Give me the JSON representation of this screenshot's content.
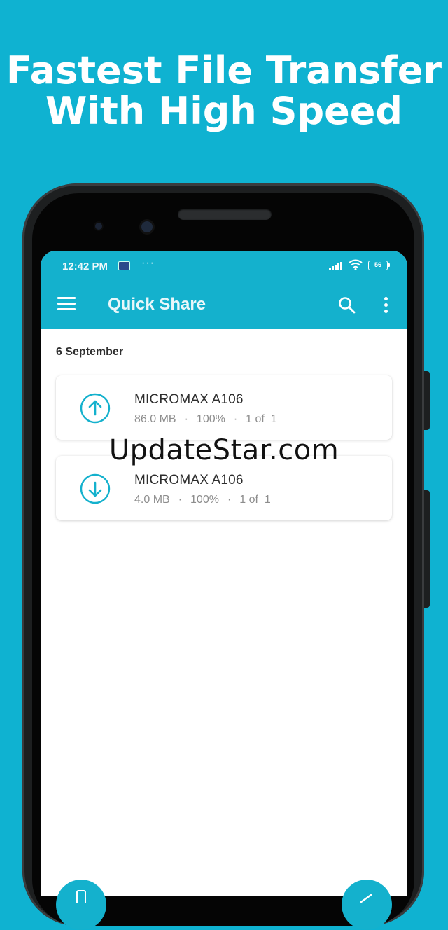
{
  "headline": {
    "line1": "Fastest File Transfer",
    "line2": "With High Speed"
  },
  "status_bar": {
    "time": "12:42 PM",
    "dots": "···",
    "battery": "56"
  },
  "app_bar": {
    "title": "Quick Share"
  },
  "list": {
    "date": "6 September",
    "items": [
      {
        "name": "MICROMAX A106",
        "size": "86.0 MB",
        "progress": "100%",
        "count": "1 of  1",
        "direction": "upload"
      },
      {
        "name": "MICROMAX A106",
        "size": "4.0 MB",
        "progress": "100%",
        "count": "1 of  1",
        "direction": "download"
      }
    ]
  },
  "watermark": "UpdateStar.com",
  "colors": {
    "background": "#0fb2d1",
    "accent": "#14b1cd"
  }
}
